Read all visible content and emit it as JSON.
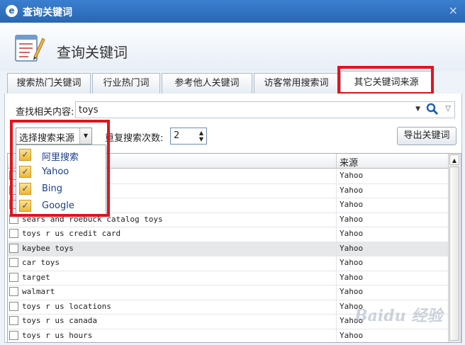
{
  "window": {
    "title": "查询关键词",
    "close_glyph": "×"
  },
  "header": {
    "title": "查询关键词"
  },
  "tabs": [
    {
      "label": "搜索热门关键词"
    },
    {
      "label": "行业热门词"
    },
    {
      "label": "参考他人关键词"
    },
    {
      "label": "访客常用搜索词"
    },
    {
      "label": "其它关键词来源",
      "active": true
    }
  ],
  "search": {
    "label": "查找相关内容:",
    "value": "toys"
  },
  "source_select": {
    "value": "选择搜索来源"
  },
  "repeat": {
    "label": "重复搜索次数:",
    "value": "2"
  },
  "export_label": "导出关键词",
  "table": {
    "col_source": "来源",
    "rows": [
      {
        "keyword": "",
        "source": "Yahoo"
      },
      {
        "keyword": "",
        "source": "Yahoo"
      },
      {
        "keyword": "",
        "source": "Yahoo"
      },
      {
        "keyword": "sears and roebuck catalog toys",
        "source": "Yahoo"
      },
      {
        "keyword": "toys r us credit card",
        "source": "Yahoo"
      },
      {
        "keyword": "kaybee toys",
        "source": "Yahoo",
        "selected": true
      },
      {
        "keyword": "car toys",
        "source": "Yahoo"
      },
      {
        "keyword": "target",
        "source": "Yahoo"
      },
      {
        "keyword": "walmart",
        "source": "Yahoo"
      },
      {
        "keyword": "toys r us locations",
        "source": "Yahoo"
      },
      {
        "keyword": "toys r us canada",
        "source": "Yahoo"
      },
      {
        "keyword": "toys r us hours",
        "source": "Yahoo"
      }
    ]
  },
  "dropdown": {
    "items": [
      {
        "label": "阿里搜索",
        "checked": true
      },
      {
        "label": "Yahoo",
        "checked": true
      },
      {
        "label": "Bing",
        "checked": true
      },
      {
        "label": "Google",
        "checked": true
      }
    ]
  },
  "watermark": "Baidu 经验",
  "colors": {
    "titlebar": "#2a66b3",
    "highlight_box": "#e0141e",
    "check": "#f3b632"
  }
}
